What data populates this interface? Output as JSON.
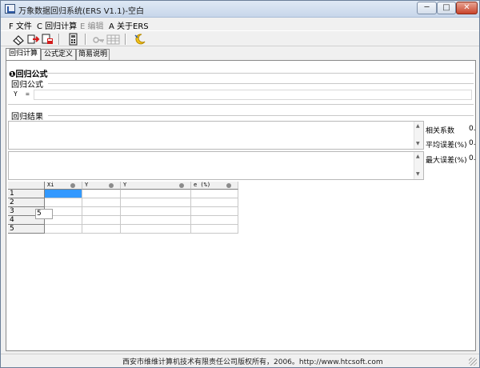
{
  "window": {
    "title": "万象数据回归系统(ERS V1.1)-空白",
    "min_glyph": "─",
    "max_glyph": "□",
    "close_glyph": "✕"
  },
  "menu": {
    "items": [
      {
        "label": "F 文件",
        "enabled": true
      },
      {
        "label": "C 回归计算",
        "enabled": true
      },
      {
        "label": "E 编辑",
        "enabled": false
      },
      {
        "label": "A 关于ERS",
        "enabled": true
      }
    ]
  },
  "toolbar": {
    "buttons": [
      "eraser-icon",
      "open-arrow-icon",
      "save-export-icon",
      "calculator-icon",
      "key-icon",
      "table-icon",
      "moon-icon"
    ]
  },
  "tabs": [
    {
      "label": "回归计算",
      "active": true
    },
    {
      "label": "公式定义",
      "active": false
    },
    {
      "label": "简易说明",
      "active": false
    }
  ],
  "formula_section": {
    "heading_icon": "❶",
    "heading": "回归公式",
    "sub_label": "回归公式",
    "y_label": "Y",
    "eq_label": "=",
    "formula_value": ""
  },
  "results_section": {
    "label": "回归结果",
    "stats": [
      {
        "label": "相关系数",
        "value": "0."
      },
      {
        "label": "平均误差(%)",
        "value": "0."
      },
      {
        "label": "最大误差(%)",
        "value": "0."
      }
    ]
  },
  "grid": {
    "columns": [
      "Xi",
      "Y",
      "Y",
      "e (%)"
    ],
    "rows": [
      "1",
      "2",
      "3",
      "4",
      "5"
    ],
    "editor_value": "5"
  },
  "status": {
    "text": "西安市维维计算机技术有限责任公司版权所有，2006。http://www.htcsoft.com"
  },
  "colors": {
    "selection": "#3399ff",
    "close_button": "#c9432b"
  }
}
